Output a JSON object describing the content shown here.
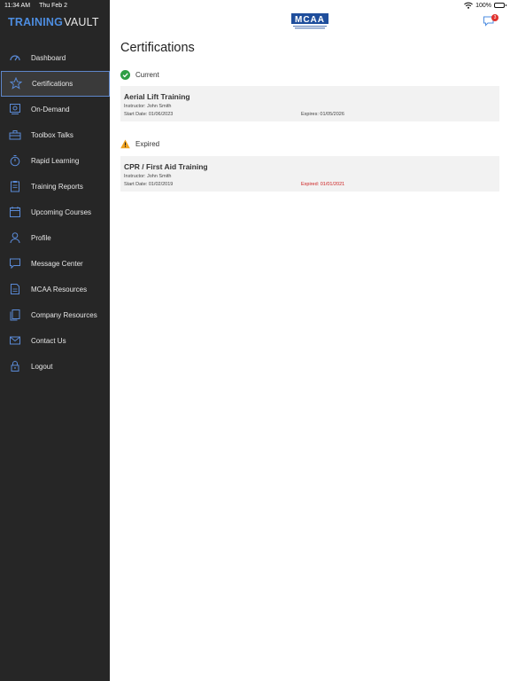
{
  "status": {
    "time": "11:34 AM",
    "date": "Thu Feb 2",
    "battery": "100%"
  },
  "brand": {
    "part1": "TRAINING",
    "part2": "VAULT"
  },
  "sidebar": {
    "items": [
      {
        "label": "Dashboard",
        "icon": "dashboard-gauge-icon"
      },
      {
        "label": "Certifications",
        "icon": "star-icon",
        "active": true
      },
      {
        "label": "On-Demand",
        "icon": "on-demand-icon"
      },
      {
        "label": "Toolbox Talks",
        "icon": "toolbox-icon"
      },
      {
        "label": "Rapid Learning",
        "icon": "stopwatch-icon"
      },
      {
        "label": "Training Reports",
        "icon": "clipboard-icon"
      },
      {
        "label": "Upcoming Courses",
        "icon": "calendar-icon"
      },
      {
        "label": "Profile",
        "icon": "user-icon"
      },
      {
        "label": "Message Center",
        "icon": "chat-bubble-icon"
      },
      {
        "label": "MCAA Resources",
        "icon": "document-icon"
      },
      {
        "label": "Company Resources",
        "icon": "documents-icon"
      },
      {
        "label": "Contact Us",
        "icon": "envelope-icon"
      },
      {
        "label": "Logout",
        "icon": "lock-icon"
      }
    ]
  },
  "header": {
    "logo_text": "MCAA",
    "notification_count": "3"
  },
  "main": {
    "title": "Certifications",
    "current": {
      "heading": "Current",
      "cards": [
        {
          "name": "Aerial Lift Training",
          "instructor": "Instructor: John Smith",
          "start": "Start Date: 01/06/2023",
          "expires": "Expires: 01/05/2026"
        }
      ]
    },
    "expired": {
      "heading": "Expired",
      "cards": [
        {
          "name": "CPR / First Aid Training",
          "instructor": "Instructor: John Smith",
          "start": "Start Date: 01/02/2019",
          "expires": "Expired: 01/01/2021"
        }
      ]
    }
  },
  "colors": {
    "accent": "#4d8de0",
    "sidebar_bg": "#262626",
    "current_green": "#2e9e44",
    "expired_amber": "#f0a21e",
    "expired_red": "#cc1f1f"
  }
}
